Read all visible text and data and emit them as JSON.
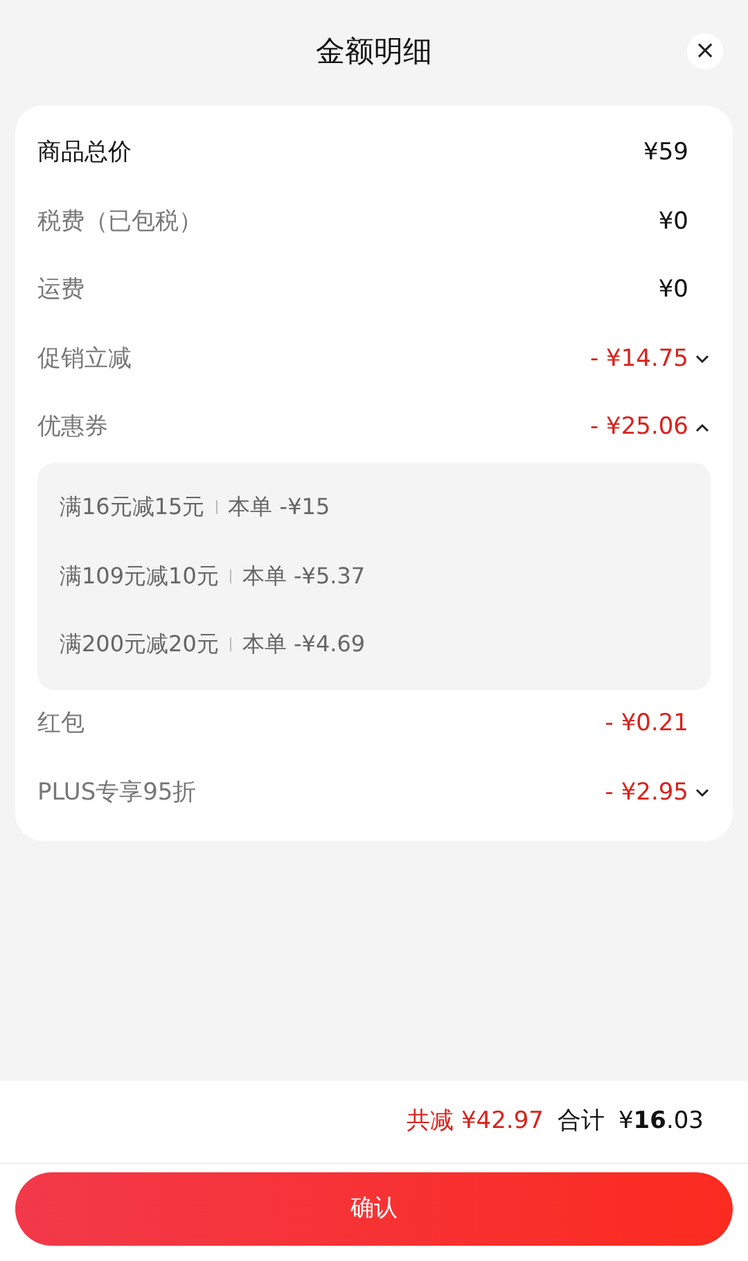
{
  "header": {
    "title": "金额明细",
    "close": "×"
  },
  "rows": [
    {
      "label": "商品总价",
      "emphasis": true,
      "value": "¥59",
      "color": "#111111"
    },
    {
      "label": "税费（已包税）",
      "emphasis": false,
      "value": "¥0",
      "color": "#111111"
    },
    {
      "label": "运费",
      "emphasis": false,
      "value": "¥0",
      "color": "#111111"
    },
    {
      "label": "促销立减",
      "emphasis": false,
      "value": "- ¥14.75",
      "color": "#d8231c",
      "expanded": false
    },
    {
      "label": "优惠券",
      "emphasis": false,
      "value": "- ¥25.06",
      "color": "#d8231c",
      "expanded": true,
      "children": [
        {
          "condition": "满16元减15元",
          "amount": "本单 -¥15"
        },
        {
          "condition": "满109元减10元",
          "amount": "本单 -¥5.37"
        },
        {
          "condition": "满200元减20元",
          "amount": "本单 -¥4.69"
        }
      ]
    },
    {
      "label": "红包",
      "emphasis": false,
      "value": "- ¥0.21",
      "color": "#d8231c"
    },
    {
      "label": "PLUS专享95折",
      "emphasis": false,
      "value": "- ¥2.95",
      "color": "#d8231c",
      "expanded": false
    }
  ],
  "summary": {
    "saved": "共减 ¥42.97",
    "total_label": "合计",
    "total": "¥**16**.03"
  },
  "confirm_button": "确认"
}
